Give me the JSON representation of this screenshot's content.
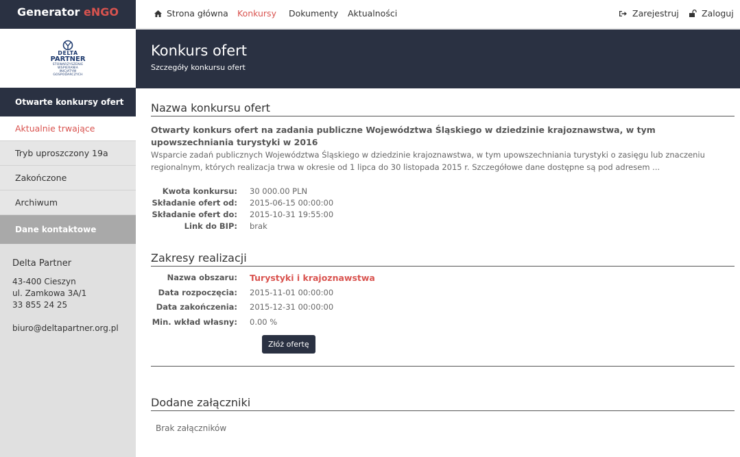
{
  "brand": {
    "name": "Generator ",
    "accent": "eNGO"
  },
  "logo": {
    "line1": "DELTA",
    "line2": "PARTNER",
    "small": [
      "STOWARZYSZENIE",
      "WSPIERANIA",
      "INICJATYW",
      "GOSPODARCZYCH"
    ]
  },
  "sidebar": {
    "section_title": "Otwarte konkursy ofert",
    "items": [
      {
        "label": "Aktualnie trwające"
      },
      {
        "label": "Tryb uproszczony 19a"
      },
      {
        "label": "Zakończone"
      },
      {
        "label": "Archiwum"
      }
    ],
    "contact_title": "Dane kontaktowe"
  },
  "contact": {
    "name": "Delta Partner",
    "address1": "43-400 Cieszyn",
    "address2": "ul. Zamkowa 3A/1",
    "phone": "33 855 24 25",
    "email": "biuro@deltapartner.org.pl"
  },
  "nav": {
    "home": "Strona główna",
    "konkursy": "Konkursy",
    "dokumenty": "Dokumenty",
    "aktualnosci": "Aktualności",
    "register": "Zarejestruj",
    "login": "Zaloguj"
  },
  "header": {
    "title": "Konkurs ofert",
    "subtitle": "Szczegóły konkursu ofert"
  },
  "competition": {
    "section_title": "Nazwa konkursu ofert",
    "title": "Otwarty konkurs ofert na zadania publiczne Województwa Śląskiego w dziedzinie krajoznawstwa, w tym upowszechniania turystyki w 2016",
    "description": "Wsparcie zadań publicznych Województwa Śląskiego w dziedzinie krajoznawstwa, w tym upowszechniania turystyki o zasięgu lub znaczeniu regionalnym, których realizacja trwa w okresie od 1 lipca do 30 listopada 2015 r. Szczegółowe dane dostępne są pod adresem ...",
    "details": [
      {
        "label": "Kwota konkursu:",
        "value": "30 000.00 PLN"
      },
      {
        "label": "Składanie ofert od:",
        "value": "2015-06-15 00:00:00"
      },
      {
        "label": "Składanie ofert do:",
        "value": "2015-10-31 19:55:00"
      },
      {
        "label": "Link do BIP:",
        "value": "brak"
      }
    ]
  },
  "scopes": {
    "section_title": "Zakresy realizacji",
    "area_label": "Nazwa obszaru:",
    "area_value": "Turystyki i krajoznawstwa",
    "details": [
      {
        "label": "Data rozpoczęcia:",
        "value": "2015-11-01 00:00:00"
      },
      {
        "label": "Data zakończenia:",
        "value": "2015-12-31 00:00:00"
      },
      {
        "label": "Min. wkład własny:",
        "value": "0.00 %"
      }
    ],
    "button": "Złóż ofertę"
  },
  "attachments": {
    "section_title": "Dodane załączniki",
    "empty": "Brak załączników"
  },
  "colors": {
    "dark": "#2a3142",
    "accent": "#d9534f",
    "sidebar_bg": "#e0e0e0"
  }
}
